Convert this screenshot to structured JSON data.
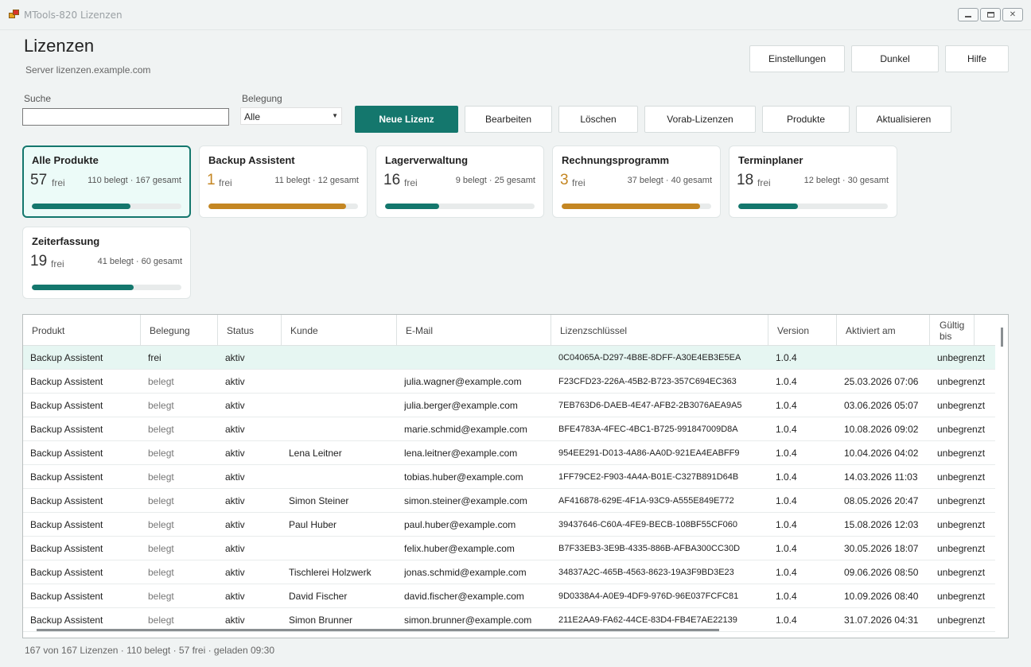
{
  "window": {
    "title": "MTools-820 Lizenzen",
    "minimize": "minimize",
    "maximize": "maximize",
    "close": "✕"
  },
  "header": {
    "title": "Lizenzen",
    "server": "Server lizenzen.example.com"
  },
  "top_actions": {
    "settings": "Einstellungen",
    "theme": "Dunkel",
    "help": "Hilfe"
  },
  "filters": {
    "search_label": "Suche",
    "search_value": "",
    "assignment_label": "Belegung",
    "assignment_value": "Alle"
  },
  "toolbar": {
    "new": "Neue Lizenz",
    "edit": "Bearbeiten",
    "delete": "Löschen",
    "pre": "Vorab-Lizenzen",
    "products": "Produkte",
    "refresh": "Aktualisieren"
  },
  "accent_color": "#14776d",
  "warning_color": "#c48622",
  "cards": [
    {
      "name": "Alle Produkte",
      "free": "57",
      "free_label": "frei",
      "stats": "110 belegt · 167 gesamt",
      "used_fraction": 0.66,
      "selected": true,
      "warn": false
    },
    {
      "name": "Backup Assistent",
      "free": "1",
      "free_label": "frei",
      "stats": "11 belegt · 12 gesamt",
      "used_fraction": 0.92,
      "selected": false,
      "warn": true
    },
    {
      "name": "Lagerverwaltung",
      "free": "16",
      "free_label": "frei",
      "stats": "9 belegt · 25 gesamt",
      "used_fraction": 0.36,
      "selected": false,
      "warn": false
    },
    {
      "name": "Rechnungsprogramm",
      "free": "3",
      "free_label": "frei",
      "stats": "37 belegt · 40 gesamt",
      "used_fraction": 0.925,
      "selected": false,
      "warn": true
    },
    {
      "name": "Terminplaner",
      "free": "18",
      "free_label": "frei",
      "stats": "12 belegt · 30 gesamt",
      "used_fraction": 0.4,
      "selected": false,
      "warn": false
    },
    {
      "name": "Zeiterfassung",
      "free": "19",
      "free_label": "frei",
      "stats": "41 belegt · 60 gesamt",
      "used_fraction": 0.683,
      "selected": false,
      "warn": false
    }
  ],
  "table": {
    "columns": [
      "Produkt",
      "Belegung",
      "Status",
      "Kunde",
      "E-Mail",
      "Lizenzschlüssel",
      "Version",
      "Aktiviert am",
      "Gültig bis"
    ],
    "rows": [
      [
        "Backup Assistent",
        "frei",
        "aktiv",
        "",
        "",
        "0C04065A-D297-4B8E-8DFF-A30E4EB3E5EA",
        "1.0.4",
        "",
        "unbegrenzt"
      ],
      [
        "Backup Assistent",
        "belegt",
        "aktiv",
        "",
        "julia.wagner@example.com",
        "F23CFD23-226A-45B2-B723-357C694EC363",
        "1.0.4",
        "25.03.2026 07:06",
        "unbegrenzt"
      ],
      [
        "Backup Assistent",
        "belegt",
        "aktiv",
        "",
        "julia.berger@example.com",
        "7EB763D6-DAEB-4E47-AFB2-2B3076AEA9A5",
        "1.0.4",
        "03.06.2026 05:07",
        "unbegrenzt"
      ],
      [
        "Backup Assistent",
        "belegt",
        "aktiv",
        "",
        "marie.schmid@example.com",
        "BFE4783A-4FEC-4BC1-B725-991847009D8A",
        "1.0.4",
        "10.08.2026 09:02",
        "unbegrenzt"
      ],
      [
        "Backup Assistent",
        "belegt",
        "aktiv",
        "Lena Leitner",
        "lena.leitner@example.com",
        "954EE291-D013-4A86-AA0D-921EA4EABFF9",
        "1.0.4",
        "10.04.2026 04:02",
        "unbegrenzt"
      ],
      [
        "Backup Assistent",
        "belegt",
        "aktiv",
        "",
        "tobias.huber@example.com",
        "1FF79CE2-F903-4A4A-B01E-C327B891D64B",
        "1.0.4",
        "14.03.2026 11:03",
        "unbegrenzt"
      ],
      [
        "Backup Assistent",
        "belegt",
        "aktiv",
        "Simon Steiner",
        "simon.steiner@example.com",
        "AF416878-629E-4F1A-93C9-A555E849E772",
        "1.0.4",
        "08.05.2026 20:47",
        "unbegrenzt"
      ],
      [
        "Backup Assistent",
        "belegt",
        "aktiv",
        "Paul Huber",
        "paul.huber@example.com",
        "39437646-C60A-4FE9-BECB-108BF55CF060",
        "1.0.4",
        "15.08.2026 12:03",
        "unbegrenzt"
      ],
      [
        "Backup Assistent",
        "belegt",
        "aktiv",
        "",
        "felix.huber@example.com",
        "B7F33EB3-3E9B-4335-886B-AFBA300CC30D",
        "1.0.4",
        "30.05.2026 18:07",
        "unbegrenzt"
      ],
      [
        "Backup Assistent",
        "belegt",
        "aktiv",
        "Tischlerei Holzwerk",
        "jonas.schmid@example.com",
        "34837A2C-465B-4563-8623-19A3F9BD3E23",
        "1.0.4",
        "09.06.2026 08:50",
        "unbegrenzt"
      ],
      [
        "Backup Assistent",
        "belegt",
        "aktiv",
        "David Fischer",
        "david.fischer@example.com",
        "9D0338A4-A0E9-4DF9-976D-96E037FCFC81",
        "1.0.4",
        "10.09.2026 08:40",
        "unbegrenzt"
      ],
      [
        "Backup Assistent",
        "belegt",
        "aktiv",
        "Simon Brunner",
        "simon.brunner@example.com",
        "211E2AA9-FA62-44CE-83D4-FB4E7AE22139",
        "1.0.4",
        "31.07.2026 04:31",
        "unbegrenzt"
      ]
    ]
  },
  "status_bar": "167 von 167 Lizenzen · 110 belegt · 57 frei · geladen 09:30"
}
